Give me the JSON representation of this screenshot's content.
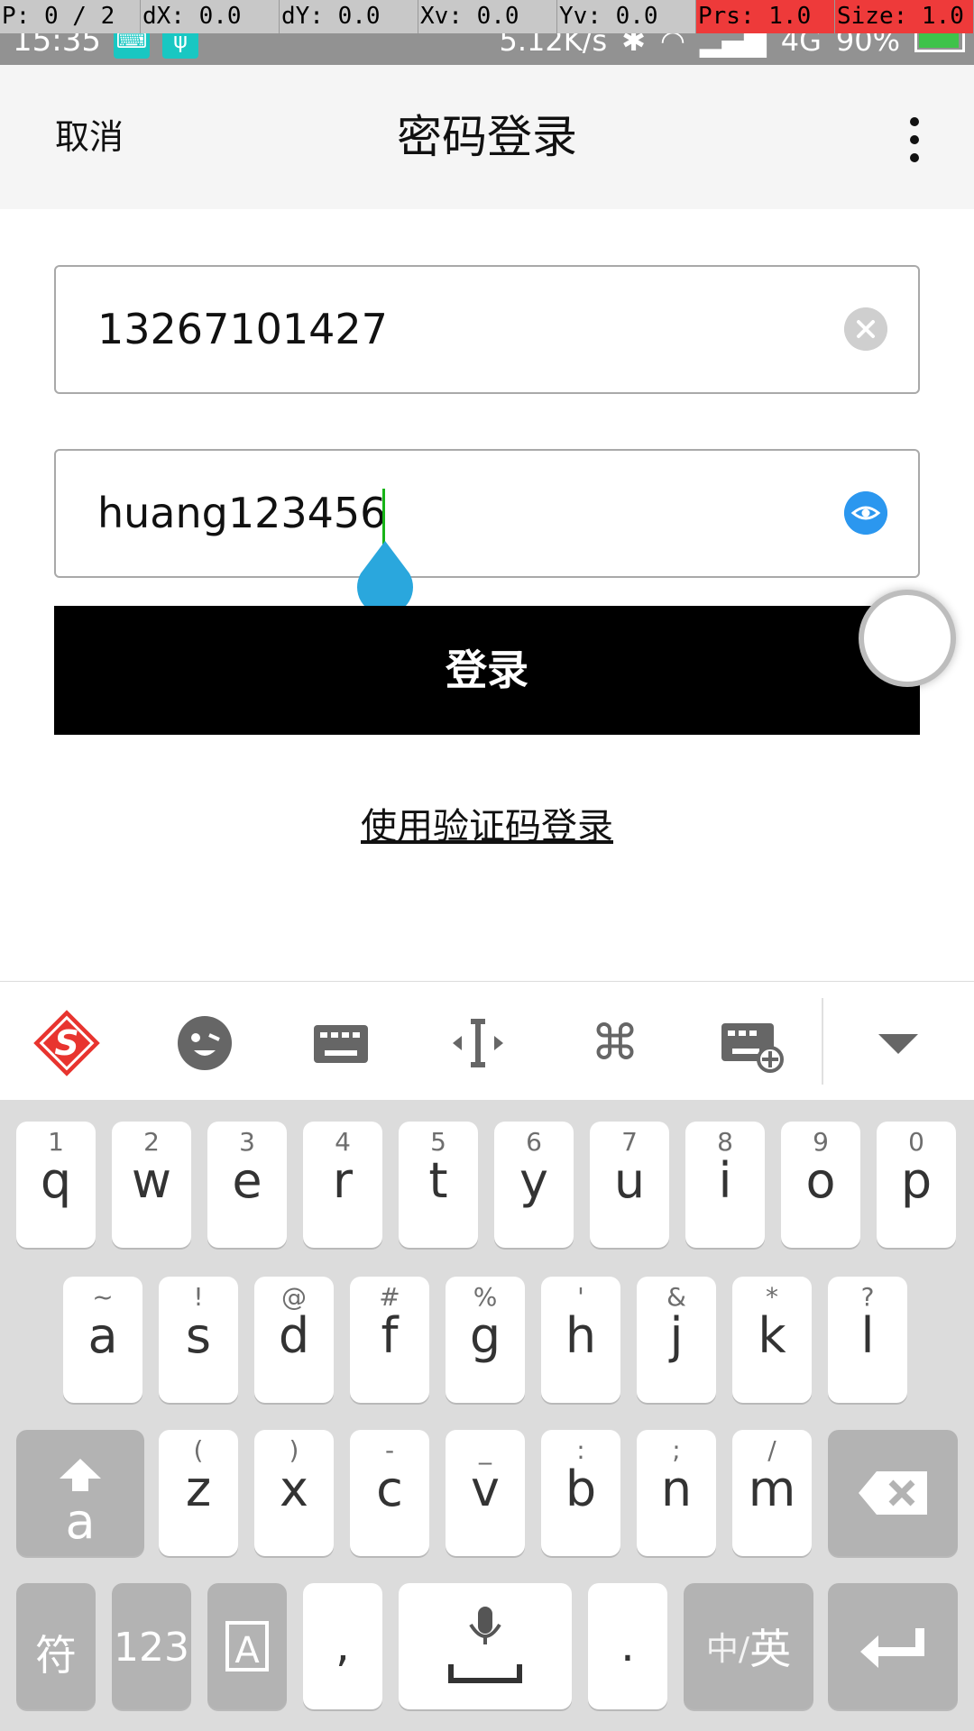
{
  "debug": [
    {
      "label": "P: 0 / 2",
      "w": 156,
      "red": false
    },
    {
      "label": "dX: 0.0",
      "w": 154,
      "red": false
    },
    {
      "label": "dY: 0.0",
      "w": 154,
      "red": false
    },
    {
      "label": "Xv: 0.0",
      "w": 154,
      "red": false
    },
    {
      "label": "Yv: 0.0",
      "w": 154,
      "red": false
    },
    {
      "label": "Prs: 1.0",
      "w": 154,
      "red": true
    },
    {
      "label": "Size: 1.0",
      "w": 154,
      "red": true
    }
  ],
  "status": {
    "time": "15:35",
    "speed": "5.12K/s",
    "network": "4G",
    "battery": "90%"
  },
  "header": {
    "cancel": "取消",
    "title": "密码登录"
  },
  "form": {
    "phone": "13267101427",
    "password": "huang123456",
    "login_label": "登录",
    "sms_link": "使用验证码登录"
  },
  "keyboard": {
    "toolbar_icons": [
      "sogou-logo-icon",
      "emoji-icon",
      "keyboard-icon",
      "cursor-move-icon",
      "command-icon",
      "keyboard-settings-icon",
      "collapse-icon"
    ],
    "row1": [
      [
        "q",
        "1"
      ],
      [
        "w",
        "2"
      ],
      [
        "e",
        "3"
      ],
      [
        "r",
        "4"
      ],
      [
        "t",
        "5"
      ],
      [
        "y",
        "6"
      ],
      [
        "u",
        "7"
      ],
      [
        "i",
        "8"
      ],
      [
        "o",
        "9"
      ],
      [
        "p",
        "0"
      ]
    ],
    "row2": [
      [
        "a",
        "~"
      ],
      [
        "s",
        "!"
      ],
      [
        "d",
        "@"
      ],
      [
        "f",
        "#"
      ],
      [
        "g",
        "%"
      ],
      [
        "h",
        "'"
      ],
      [
        "j",
        "&"
      ],
      [
        "k",
        "*"
      ],
      [
        "l",
        "?"
      ]
    ],
    "row3": [
      [
        "z",
        "("
      ],
      [
        "x",
        ")"
      ],
      [
        "c",
        "-"
      ],
      [
        "v",
        "_"
      ],
      [
        "b",
        ":"
      ],
      [
        "n",
        ";"
      ],
      [
        "m",
        "/"
      ]
    ],
    "shift_label": "a",
    "symbol_key": "符",
    "num_key": "123",
    "comma_key": ",",
    "period_key": ".",
    "lang_key_prefix": "中/",
    "lang_key_main": "英"
  }
}
